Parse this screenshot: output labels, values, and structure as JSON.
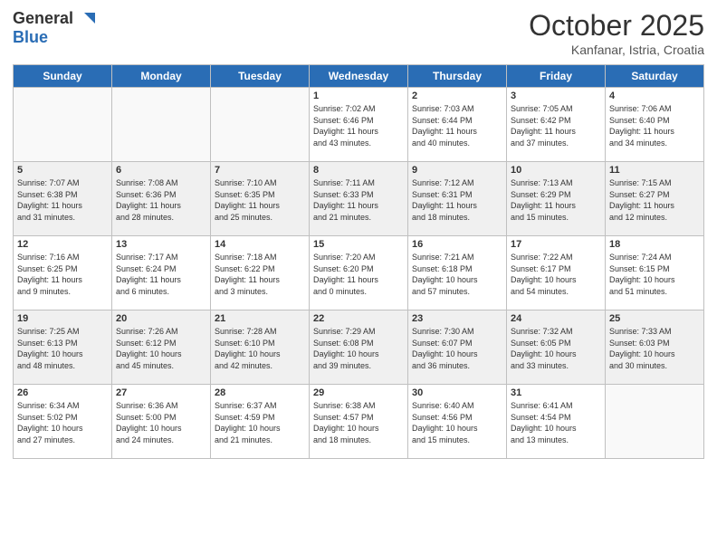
{
  "header": {
    "logo": {
      "general": "General",
      "blue": "Blue"
    },
    "title": "October 2025",
    "subtitle": "Kanfanar, Istria, Croatia"
  },
  "weekdays": [
    "Sunday",
    "Monday",
    "Tuesday",
    "Wednesday",
    "Thursday",
    "Friday",
    "Saturday"
  ],
  "weeks": [
    [
      {
        "day": "",
        "info": ""
      },
      {
        "day": "",
        "info": ""
      },
      {
        "day": "",
        "info": ""
      },
      {
        "day": "1",
        "info": "Sunrise: 7:02 AM\nSunset: 6:46 PM\nDaylight: 11 hours\nand 43 minutes."
      },
      {
        "day": "2",
        "info": "Sunrise: 7:03 AM\nSunset: 6:44 PM\nDaylight: 11 hours\nand 40 minutes."
      },
      {
        "day": "3",
        "info": "Sunrise: 7:05 AM\nSunset: 6:42 PM\nDaylight: 11 hours\nand 37 minutes."
      },
      {
        "day": "4",
        "info": "Sunrise: 7:06 AM\nSunset: 6:40 PM\nDaylight: 11 hours\nand 34 minutes."
      }
    ],
    [
      {
        "day": "5",
        "info": "Sunrise: 7:07 AM\nSunset: 6:38 PM\nDaylight: 11 hours\nand 31 minutes."
      },
      {
        "day": "6",
        "info": "Sunrise: 7:08 AM\nSunset: 6:36 PM\nDaylight: 11 hours\nand 28 minutes."
      },
      {
        "day": "7",
        "info": "Sunrise: 7:10 AM\nSunset: 6:35 PM\nDaylight: 11 hours\nand 25 minutes."
      },
      {
        "day": "8",
        "info": "Sunrise: 7:11 AM\nSunset: 6:33 PM\nDaylight: 11 hours\nand 21 minutes."
      },
      {
        "day": "9",
        "info": "Sunrise: 7:12 AM\nSunset: 6:31 PM\nDaylight: 11 hours\nand 18 minutes."
      },
      {
        "day": "10",
        "info": "Sunrise: 7:13 AM\nSunset: 6:29 PM\nDaylight: 11 hours\nand 15 minutes."
      },
      {
        "day": "11",
        "info": "Sunrise: 7:15 AM\nSunset: 6:27 PM\nDaylight: 11 hours\nand 12 minutes."
      }
    ],
    [
      {
        "day": "12",
        "info": "Sunrise: 7:16 AM\nSunset: 6:25 PM\nDaylight: 11 hours\nand 9 minutes."
      },
      {
        "day": "13",
        "info": "Sunrise: 7:17 AM\nSunset: 6:24 PM\nDaylight: 11 hours\nand 6 minutes."
      },
      {
        "day": "14",
        "info": "Sunrise: 7:18 AM\nSunset: 6:22 PM\nDaylight: 11 hours\nand 3 minutes."
      },
      {
        "day": "15",
        "info": "Sunrise: 7:20 AM\nSunset: 6:20 PM\nDaylight: 11 hours\nand 0 minutes."
      },
      {
        "day": "16",
        "info": "Sunrise: 7:21 AM\nSunset: 6:18 PM\nDaylight: 10 hours\nand 57 minutes."
      },
      {
        "day": "17",
        "info": "Sunrise: 7:22 AM\nSunset: 6:17 PM\nDaylight: 10 hours\nand 54 minutes."
      },
      {
        "day": "18",
        "info": "Sunrise: 7:24 AM\nSunset: 6:15 PM\nDaylight: 10 hours\nand 51 minutes."
      }
    ],
    [
      {
        "day": "19",
        "info": "Sunrise: 7:25 AM\nSunset: 6:13 PM\nDaylight: 10 hours\nand 48 minutes."
      },
      {
        "day": "20",
        "info": "Sunrise: 7:26 AM\nSunset: 6:12 PM\nDaylight: 10 hours\nand 45 minutes."
      },
      {
        "day": "21",
        "info": "Sunrise: 7:28 AM\nSunset: 6:10 PM\nDaylight: 10 hours\nand 42 minutes."
      },
      {
        "day": "22",
        "info": "Sunrise: 7:29 AM\nSunset: 6:08 PM\nDaylight: 10 hours\nand 39 minutes."
      },
      {
        "day": "23",
        "info": "Sunrise: 7:30 AM\nSunset: 6:07 PM\nDaylight: 10 hours\nand 36 minutes."
      },
      {
        "day": "24",
        "info": "Sunrise: 7:32 AM\nSunset: 6:05 PM\nDaylight: 10 hours\nand 33 minutes."
      },
      {
        "day": "25",
        "info": "Sunrise: 7:33 AM\nSunset: 6:03 PM\nDaylight: 10 hours\nand 30 minutes."
      }
    ],
    [
      {
        "day": "26",
        "info": "Sunrise: 6:34 AM\nSunset: 5:02 PM\nDaylight: 10 hours\nand 27 minutes."
      },
      {
        "day": "27",
        "info": "Sunrise: 6:36 AM\nSunset: 5:00 PM\nDaylight: 10 hours\nand 24 minutes."
      },
      {
        "day": "28",
        "info": "Sunrise: 6:37 AM\nSunset: 4:59 PM\nDaylight: 10 hours\nand 21 minutes."
      },
      {
        "day": "29",
        "info": "Sunrise: 6:38 AM\nSunset: 4:57 PM\nDaylight: 10 hours\nand 18 minutes."
      },
      {
        "day": "30",
        "info": "Sunrise: 6:40 AM\nSunset: 4:56 PM\nDaylight: 10 hours\nand 15 minutes."
      },
      {
        "day": "31",
        "info": "Sunrise: 6:41 AM\nSunset: 4:54 PM\nDaylight: 10 hours\nand 13 minutes."
      },
      {
        "day": "",
        "info": ""
      }
    ]
  ]
}
